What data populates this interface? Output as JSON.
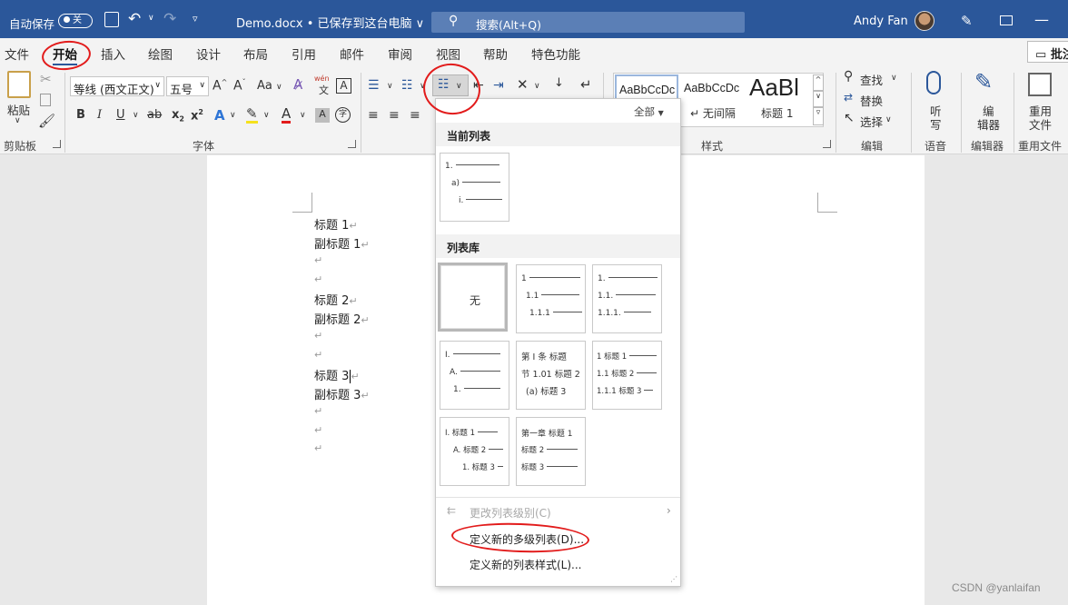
{
  "title_bar": {
    "autosave_label": "自动保存",
    "autosave_toggle": "关",
    "doc_name": "Demo.docx • 已保存到这台电脑 ∨",
    "search_placeholder": "搜索(Alt+Q)",
    "user_name": "Andy Fan"
  },
  "tabs": [
    "文件",
    "开始",
    "插入",
    "绘图",
    "设计",
    "布局",
    "引用",
    "邮件",
    "审阅",
    "视图",
    "帮助",
    "特色功能"
  ],
  "comment_button": "批注",
  "ribbon": {
    "clipboard": {
      "paste": "粘贴",
      "group_label": "剪贴板"
    },
    "font": {
      "font_name": "等线 (西文正文)",
      "font_size": "五号",
      "grow": "A",
      "shrink": "A",
      "change_case": "Aa",
      "phonetic": "wén",
      "border_char": "A",
      "bold": "B",
      "italic": "I",
      "underline": "U",
      "strike": "ab",
      "subscript": "x",
      "superscript": "x",
      "highlight_char": "A",
      "group_label": "字体"
    },
    "styles": {
      "samples": [
        {
          "preview": "AaBbCcDc",
          "name": ""
        },
        {
          "preview": "AaBbCcDc",
          "name": "↵ 无间隔"
        },
        {
          "preview": "AaBl",
          "name": "标题 1"
        }
      ],
      "group_label": "样式"
    },
    "editing": {
      "find": "查找",
      "replace": "替换",
      "select": "选择",
      "group_label": "编辑"
    },
    "voice": {
      "dictate_line1": "听",
      "dictate_line2": "写",
      "group_label": "语音"
    },
    "editor": {
      "line1": "编",
      "line2": "辑器",
      "group_label": "编辑器"
    },
    "reuse": {
      "line1": "重用",
      "line2": "文件",
      "group_label": "重用文件"
    }
  },
  "document": {
    "lines": [
      "标题 1",
      "副标题 1",
      "",
      "",
      "标题 2",
      "副标题 2",
      "",
      "",
      "标题 3",
      "副标题 3",
      "",
      "",
      ""
    ]
  },
  "dropdown": {
    "filter": "全部",
    "current_header": "当前列表",
    "library_header": "列表库",
    "current_tile": [
      "1.",
      "a)",
      "i."
    ],
    "tiles": [
      [
        "无"
      ],
      [
        "1",
        "1.1",
        "1.1.1"
      ],
      [
        "1.",
        "1.1.",
        "1.1.1."
      ],
      [
        "I.",
        "A.",
        "1."
      ],
      [
        "第 I 条 标题",
        "节 1.01 标题 2",
        "(a) 标题 3"
      ],
      [
        "1 标题 1",
        "1.1 标题 2",
        "1.1.1 标题 3"
      ],
      [
        "I. 标题 1",
        "A. 标题 2",
        "1. 标题 3"
      ],
      [
        "第一章 标题 1",
        "标题 2",
        "标题 3"
      ]
    ],
    "change_level": "更改列表级别(C)",
    "define_multilevel": "定义新的多级列表(D)...",
    "define_style": "定义新的列表样式(L)..."
  },
  "watermark": "CSDN @yanlaifan",
  "colors": {
    "titlebar": "#2b579a",
    "annotation": "#e21b1b"
  }
}
